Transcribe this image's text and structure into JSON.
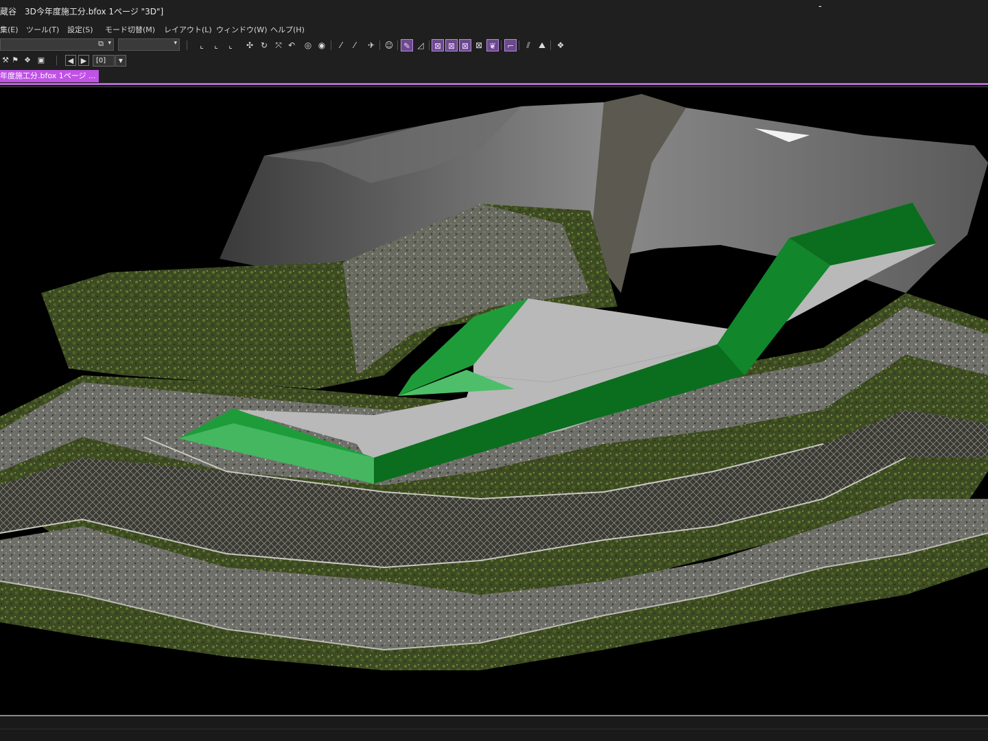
{
  "window": {
    "title": "蔵谷　3D今年度施工分.bfox 1ページ \"3D\"]",
    "minimize_glyph": "-"
  },
  "menu": [
    {
      "label": "集(E)"
    },
    {
      "label": "ツール(T)"
    },
    {
      "label": "設定(S)"
    },
    {
      "label": "モード切替(M)"
    },
    {
      "label": "レイアウト(L)"
    },
    {
      "label": "ウィンドウ(W)"
    },
    {
      "label": "ヘルプ(H)"
    }
  ],
  "toolbar": {
    "layer_combo_value": "",
    "view_combo_value": "",
    "frame_value": "[0]",
    "icons": [
      "copy-icon",
      "axis-x-icon",
      "axis-y-icon",
      "axis-z-icon",
      "move-icon",
      "rotate-icon",
      "transform-icon",
      "undo-view-icon",
      "camera-icon",
      "camera-rotate-icon",
      "brush-icon",
      "eraser-icon",
      "plane-icon",
      "walk-icon",
      "pen-icon",
      "slope-icon",
      "box-x-icon",
      "box-fill-icon",
      "box-wire-icon",
      "cross-icon",
      "leaf-icon",
      "line-icon",
      "stair-icon",
      "terrain-icon",
      "layers-icon"
    ]
  },
  "document_tab": {
    "label": "年度施工分.bfox 1ページ ..."
  },
  "colors": {
    "accent": "#c052e6",
    "chrome": "#1f1f1f",
    "model_top": "#b9b9b9",
    "model_slope_dark": "#0b6e1e",
    "model_slope_mid": "#1e9c3a",
    "model_slope_light": "#4fbe6a"
  }
}
